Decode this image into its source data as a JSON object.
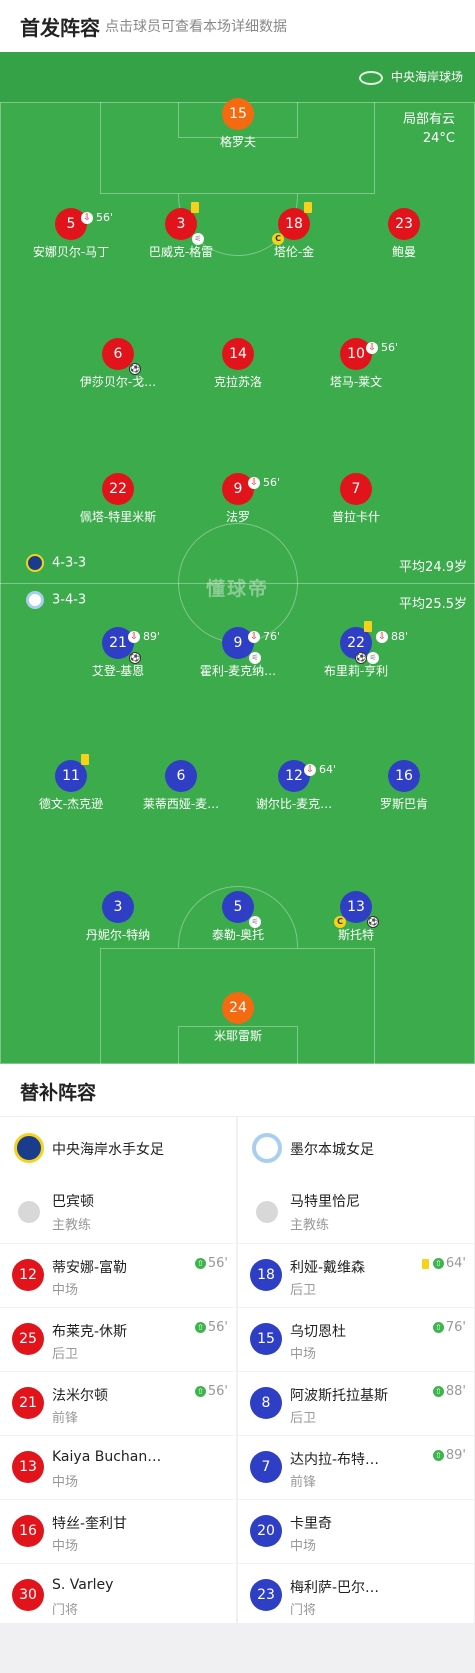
{
  "header": {
    "title": "首发阵容",
    "subtitle": "点击球员可查看本场详细数据"
  },
  "pitch": {
    "stadium": "中央海岸球场",
    "weather": "局部有云",
    "temperature": "24°C",
    "watermark": "懂球帝",
    "home_formation": "4-3-3",
    "home_avg_age": "平均24.9岁",
    "away_formation": "3-4-3",
    "away_avg_age": "平均25.5岁"
  },
  "home_lineup": {
    "gk": {
      "number": "15",
      "name": "格罗夫"
    },
    "def": [
      {
        "number": "5",
        "name": "安娜贝尔-马丁",
        "sub": "56'"
      },
      {
        "number": "3",
        "name": "巴威克-格雷"
      },
      {
        "number": "18",
        "name": "塔伦-金"
      },
      {
        "number": "23",
        "name": "鲍曼"
      }
    ],
    "mid": [
      {
        "number": "6",
        "name": "伊莎贝尔-戈…"
      },
      {
        "number": "14",
        "name": "克拉苏洛"
      },
      {
        "number": "10",
        "name": "塔马-莱文",
        "sub": "56'"
      }
    ],
    "fwd": [
      {
        "number": "22",
        "name": "佩塔-特里米斯"
      },
      {
        "number": "9",
        "name": "法罗",
        "sub": "56'"
      },
      {
        "number": "7",
        "name": "普拉卡什"
      }
    ]
  },
  "away_lineup": {
    "fwd": [
      {
        "number": "21",
        "name": "艾登-基恩",
        "sub": "89'"
      },
      {
        "number": "9",
        "name": "霍利-麦克纳…",
        "sub": "76'"
      },
      {
        "number": "22",
        "name": "布里莉-亨利",
        "sub": "88'"
      }
    ],
    "mid": [
      {
        "number": "11",
        "name": "德文-杰克逊"
      },
      {
        "number": "6",
        "name": "莱蒂西娅-麦…"
      },
      {
        "number": "12",
        "name": "谢尔比-麦克…",
        "sub": "64'"
      },
      {
        "number": "16",
        "name": "罗斯巴肯"
      }
    ],
    "def": [
      {
        "number": "3",
        "name": "丹妮尔-特纳"
      },
      {
        "number": "5",
        "name": "泰勒-奥托"
      },
      {
        "number": "13",
        "name": "斯托特"
      }
    ],
    "gk": {
      "number": "24",
      "name": "米耶雷斯"
    }
  },
  "subs": {
    "title": "替补阵容",
    "home": {
      "team": "中央海岸水手女足",
      "coach": {
        "name": "巴宾顿",
        "role": "主教练"
      },
      "players": [
        {
          "number": "12",
          "name": "蒂安娜-富勒",
          "pos": "中场",
          "time": "56'"
        },
        {
          "number": "25",
          "name": "布莱克-休斯",
          "pos": "后卫",
          "time": "56'"
        },
        {
          "number": "21",
          "name": "法米尔顿",
          "pos": "前锋",
          "time": "56'"
        },
        {
          "number": "13",
          "name": "Kaiya Buchan…",
          "pos": "中场",
          "time": ""
        },
        {
          "number": "16",
          "name": "特丝-奎利甘",
          "pos": "中场",
          "time": ""
        },
        {
          "number": "30",
          "name": "S. Varley",
          "pos": "门将",
          "time": ""
        }
      ]
    },
    "away": {
      "team": "墨尔本城女足",
      "coach": {
        "name": "马特里恰尼",
        "role": "主教练"
      },
      "players": [
        {
          "number": "18",
          "name": "利娅-戴维森",
          "pos": "后卫",
          "time": "64'"
        },
        {
          "number": "15",
          "name": "乌切恩杜",
          "pos": "中场",
          "time": "76'"
        },
        {
          "number": "8",
          "name": "阿波斯托拉基斯",
          "pos": "后卫",
          "time": "88'"
        },
        {
          "number": "7",
          "name": "达内拉-布特…",
          "pos": "前锋",
          "time": "89'"
        },
        {
          "number": "20",
          "name": "卡里奇",
          "pos": "中场",
          "time": ""
        },
        {
          "number": "23",
          "name": "梅利萨-巴尔…",
          "pos": "门将",
          "time": ""
        }
      ]
    }
  },
  "colors": {
    "pitch": "#3cab4c",
    "home": "#e1141b",
    "away": "#2f3fc5",
    "gk": "#f46a10",
    "yellow_card": "#f7d21a"
  }
}
